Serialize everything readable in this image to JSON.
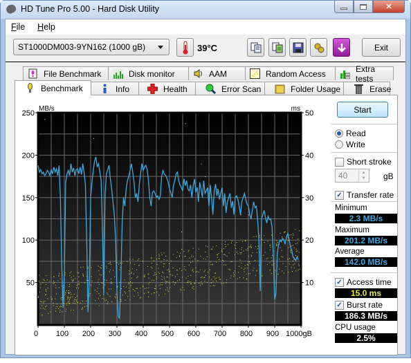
{
  "window": {
    "title": "HD Tune Pro 5.00 - Hard Disk Utility",
    "controls": {
      "minimize": "minimize",
      "maximize": "maximize",
      "close": "close"
    }
  },
  "menu": {
    "items": [
      {
        "label": "File",
        "accel": "F"
      },
      {
        "label": "Help",
        "accel": "H"
      }
    ]
  },
  "toolbar": {
    "drive_selected": "ST1000DM003-9YN162 (1000 gB)",
    "temperature": "39°C",
    "icons": [
      "thermometer-icon",
      "copy-text-icon",
      "copy-screenshot-icon",
      "save-icon",
      "options-icon",
      "download-icon"
    ],
    "exit_label": "Exit"
  },
  "tabs": {
    "top_row": [
      {
        "label": "File Benchmark",
        "icon": "file-benchmark-icon"
      },
      {
        "label": "Disk monitor",
        "icon": "disk-monitor-icon"
      },
      {
        "label": "AAM",
        "icon": "speaker-icon"
      },
      {
        "label": "Random Access",
        "icon": "random-access-icon"
      },
      {
        "label": "Extra tests",
        "icon": "extra-tests-icon"
      }
    ],
    "bottom_row": [
      {
        "label": "Benchmark",
        "icon": "benchmark-icon",
        "active": true
      },
      {
        "label": "Info",
        "icon": "info-icon"
      },
      {
        "label": "Health",
        "icon": "health-icon"
      },
      {
        "label": "Error Scan",
        "icon": "error-scan-icon"
      },
      {
        "label": "Folder Usage",
        "icon": "folder-icon"
      },
      {
        "label": "Erase",
        "icon": "trash-icon"
      }
    ]
  },
  "side": {
    "start_label": "Start",
    "read_label": "Read",
    "write_label": "Write",
    "mode": "Read",
    "short_stroke_label": "Short stroke",
    "short_stroke_checked": false,
    "short_stroke_value": "40",
    "short_stroke_unit": "gB",
    "transfer_rate_label": "Transfer rate",
    "transfer_rate_checked": true,
    "minimum_label": "Minimum",
    "minimum_value": "2.3 MB/s",
    "maximum_label": "Maximum",
    "maximum_value": "201.2 MB/s",
    "average_label": "Average",
    "average_value": "142.0 MB/s",
    "access_time_label": "Access time",
    "access_time_checked": true,
    "access_time_value": "15.0 ms",
    "burst_rate_label": "Burst rate",
    "burst_rate_checked": true,
    "burst_rate_value": "186.3 MB/s",
    "cpu_usage_label": "CPU usage",
    "cpu_usage_value": "2.5%",
    "colors": {
      "transfer": "#3fa9dd",
      "access": "#e8e850",
      "burst": "#ffffff"
    }
  },
  "chart_data": {
    "type": "line",
    "title": "",
    "xlabel": "gB",
    "ylabel": "MB/s",
    "y2label": "ms",
    "xlim": [
      0,
      1000
    ],
    "ylim": [
      0,
      250
    ],
    "y2lim": [
      0,
      50
    ],
    "x_ticks": [
      "0",
      "100",
      "200",
      "300",
      "400",
      "500",
      "600",
      "700",
      "800",
      "900",
      "1000gB"
    ],
    "y_ticks": [
      "50",
      "100",
      "150",
      "200",
      "250"
    ],
    "y2_ticks": [
      "10",
      "20",
      "30",
      "40",
      "50"
    ],
    "grid": true,
    "series": [
      {
        "name": "Transfer rate (MB/s)",
        "color": "#3fa9dd",
        "x": [
          0,
          5,
          10,
          15,
          20,
          25,
          30,
          35,
          40,
          45,
          50,
          55,
          60,
          65,
          70,
          75,
          80,
          85,
          90,
          95,
          100,
          105,
          110,
          115,
          120,
          125,
          130,
          135,
          140,
          145,
          150,
          155,
          160,
          165,
          170,
          175,
          180,
          185,
          190,
          195,
          200,
          205,
          210,
          215,
          220,
          225,
          230,
          235,
          240,
          245,
          250,
          255,
          260,
          265,
          270,
          275,
          280,
          285,
          290,
          295,
          300,
          305,
          310,
          315,
          320,
          325,
          330,
          335,
          340,
          345,
          350,
          355,
          360,
          365,
          370,
          375,
          380,
          385,
          390,
          395,
          400,
          405,
          410,
          415,
          420,
          425,
          430,
          435,
          440,
          445,
          450,
          455,
          460,
          465,
          470,
          475,
          480,
          485,
          490,
          495,
          500,
          505,
          510,
          515,
          520,
          525,
          530,
          535,
          540,
          545,
          550,
          555,
          560,
          565,
          570,
          575,
          580,
          585,
          590,
          595,
          600,
          605,
          610,
          615,
          620,
          625,
          630,
          635,
          640,
          645,
          650,
          655,
          660,
          665,
          670,
          675,
          680,
          685,
          690,
          695,
          700,
          705,
          710,
          715,
          720,
          725,
          730,
          735,
          740,
          745,
          750,
          755,
          760,
          765,
          770,
          775,
          780,
          785,
          790,
          795,
          800,
          805,
          810,
          815,
          820,
          825,
          830,
          835,
          840,
          845,
          850,
          855,
          860,
          865,
          870,
          875,
          880,
          885,
          890,
          895,
          900,
          905,
          910,
          915,
          920,
          925,
          930,
          935,
          940,
          945,
          950,
          955,
          960,
          965,
          970,
          975,
          980,
          985,
          990,
          995,
          1000
        ],
        "y": [
          188,
          180,
          183,
          178,
          180,
          176,
          178,
          182,
          180,
          176,
          183,
          178,
          186,
          180,
          184,
          176,
          188,
          150,
          70,
          20,
          60,
          168,
          178,
          182,
          176,
          190,
          180,
          185,
          176,
          183,
          184,
          178,
          186,
          177,
          190,
          180,
          165,
          100,
          15,
          55,
          150,
          168,
          182,
          193,
          198,
          186,
          190,
          180,
          170,
          110,
          35,
          155,
          178,
          183,
          188,
          172,
          160,
          145,
          130,
          100,
          40,
          10,
          8,
          55,
          120,
          150,
          140,
          160,
          170,
          175,
          182,
          190,
          180,
          168,
          150,
          155,
          145,
          165,
          178,
          190,
          182,
          186,
          188,
          183,
          170,
          150,
          140,
          156,
          158,
          155,
          150,
          152,
          148,
          152,
          175,
          182,
          178,
          176,
          173,
          168,
          160,
          156,
          150,
          164,
          170,
          178,
          180,
          170,
          165,
          162,
          158,
          172,
          164,
          170,
          160,
          158,
          165,
          150,
          164,
          172,
          156,
          162,
          145,
          168,
          160,
          150,
          170,
          155,
          158,
          162,
          140,
          165,
          150,
          130,
          158,
          166,
          152,
          160,
          148,
          155,
          162,
          140,
          155,
          132,
          145,
          150,
          155,
          138,
          146,
          130,
          150,
          152,
          148,
          140,
          130,
          145,
          150,
          155,
          148,
          142,
          140,
          130,
          125,
          135,
          145,
          138,
          140,
          125,
          100,
          40,
          125,
          130,
          135,
          126,
          120,
          128,
          124,
          125,
          115,
          80,
          30,
          38,
          85,
          95,
          100,
          98,
          102,
          100,
          95,
          104,
          108,
          100,
          92,
          88,
          80,
          78,
          76,
          80,
          77
        ]
      },
      {
        "name": "Access time (ms)",
        "color": "#e8e850",
        "type": "scatter",
        "trend": "increasing from ~5-12 ms at 0 gB to ~15-22 ms at 1000 gB",
        "average": 15.0
      }
    ]
  }
}
